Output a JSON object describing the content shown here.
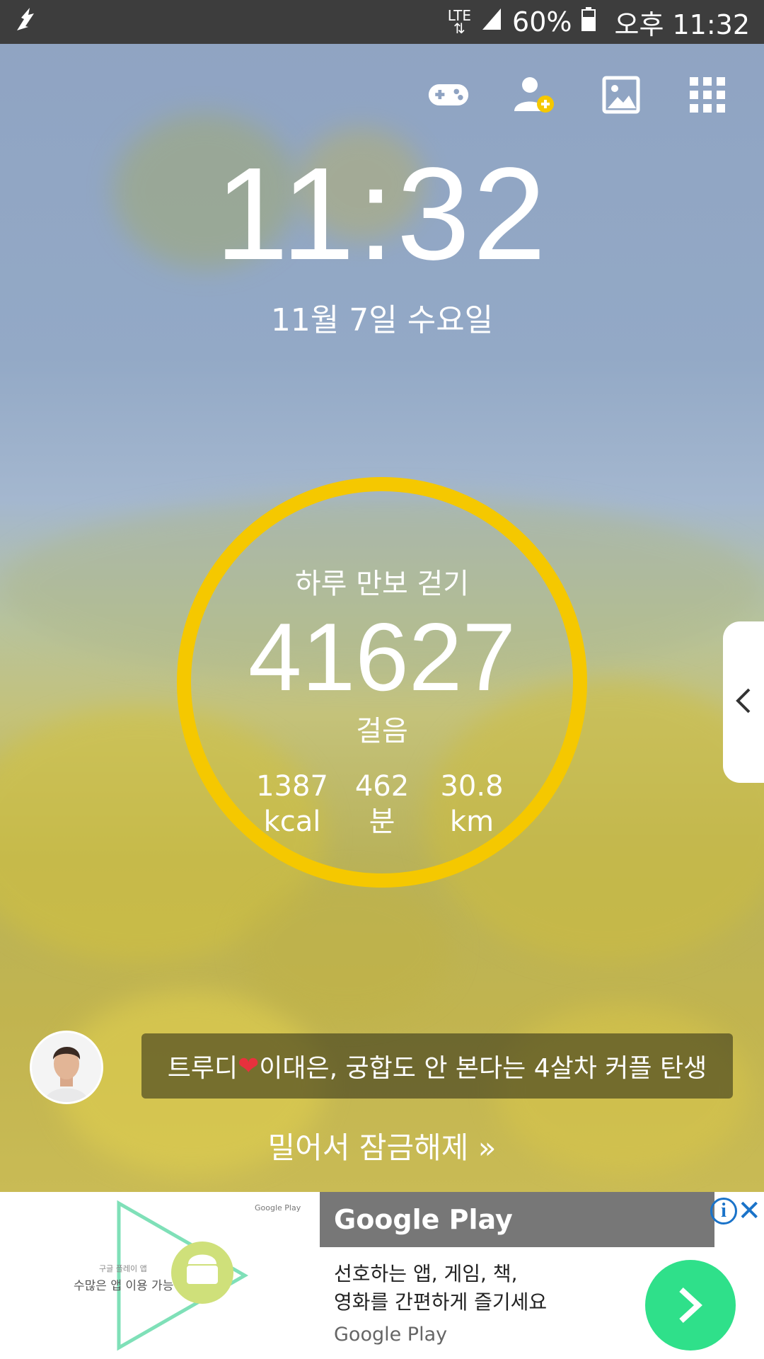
{
  "status_bar": {
    "network": "LTE",
    "battery": "60%",
    "time": "오후 11:32",
    "icons": [
      "app-notification-icon",
      "lte-icon",
      "signal-icon",
      "battery-icon"
    ]
  },
  "top_icons": [
    "gamepad-icon",
    "add-user-icon",
    "image-icon",
    "apps-grid-icon"
  ],
  "lockscreen": {
    "time": "11:32",
    "date": "11월 7일 수요일"
  },
  "pedometer": {
    "title": "하루 만보 걷기",
    "steps": "41627",
    "steps_unit": "걸음",
    "ring_color": "#f5c800",
    "stats": [
      {
        "value": "1387",
        "unit": "kcal"
      },
      {
        "value": "462",
        "unit": "분"
      },
      {
        "value": "30.8",
        "unit": "km"
      }
    ]
  },
  "news": {
    "text_before": "트루디",
    "heart": "❤",
    "text_after": "이대은, 궁합도 안 본다는 4살차 커플 탄생"
  },
  "unlock": {
    "label": "밀어서 잠금해제",
    "arrows": "»"
  },
  "ad": {
    "left_logo": "Google Play",
    "left_small_1": "구글 플레이 앱",
    "left_small_2": "수많은 앱 이용 가능",
    "title": "Google Play",
    "body_line1": "선호하는 앱, 게임, 책,",
    "body_line2": "영화를 간편하게 즐기세요",
    "source": "Google Play",
    "accent": "#2fe08a"
  }
}
